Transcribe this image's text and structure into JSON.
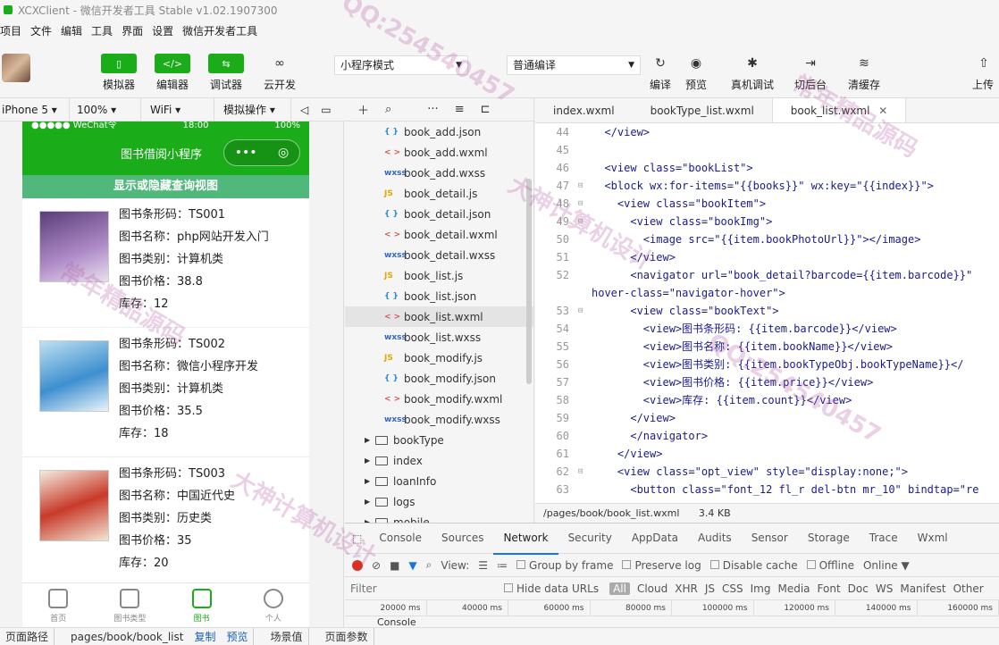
{
  "window": {
    "title": "XCXClient - 微信开发者工具 Stable v1.02.1907300"
  },
  "menu": [
    "项目",
    "文件",
    "编辑",
    "工具",
    "界面",
    "设置",
    "微信开发者工具"
  ],
  "toolbar": {
    "simulator": "模拟器",
    "editor": "编辑器",
    "debugger": "调试器",
    "cloud": "云开发",
    "mode": "小程序模式",
    "compile_mode": "普通编译",
    "compile": "编译",
    "preview": "预览",
    "remote_debug": "真机调试",
    "background": "切后台",
    "clear_cache": "清缓存",
    "upload": "上传"
  },
  "device_bar": {
    "device": "iPhone 5",
    "zoom": "100%",
    "network": "WiFi",
    "simulate": "模拟操作"
  },
  "phone": {
    "status_left": "●●●●● WeChat令",
    "status_time": "18:00",
    "status_right": "100%",
    "nav_title": "图书借阅小程序",
    "show_bar": "显示或隐藏查询视图",
    "books": [
      {
        "barcode": "图书条形码：TS001",
        "name": "图书名称：php网站开发入门",
        "type": "图书类别：计算机类",
        "price": "图书价格：38.8",
        "count": "库存：12"
      },
      {
        "barcode": "图书条形码：TS002",
        "name": "图书名称：微信小程序开发",
        "type": "图书类别：计算机类",
        "price": "图书价格：35.5",
        "count": "库存：18"
      },
      {
        "barcode": "图书条形码：TS003",
        "name": "图书名称：中国近代史",
        "type": "图书类别：历史类",
        "price": "图书价格：35",
        "count": "库存：20"
      }
    ],
    "tabs": [
      "首页",
      "图书类型",
      "图书",
      "个人"
    ]
  },
  "filetree": {
    "files": [
      {
        "ext": "{ }",
        "name": "book_add.json"
      },
      {
        "ext": "< >",
        "name": "book_add.wxml"
      },
      {
        "ext": "wxss",
        "name": "book_add.wxss"
      },
      {
        "ext": "JS",
        "name": "book_detail.js"
      },
      {
        "ext": "{ }",
        "name": "book_detail.json"
      },
      {
        "ext": "< >",
        "name": "book_detail.wxml"
      },
      {
        "ext": "wxss",
        "name": "book_detail.wxss"
      },
      {
        "ext": "JS",
        "name": "book_list.js"
      },
      {
        "ext": "{ }",
        "name": "book_list.json"
      },
      {
        "ext": "< >",
        "name": "book_list.wxml"
      },
      {
        "ext": "wxss",
        "name": "book_list.wxss"
      },
      {
        "ext": "JS",
        "name": "book_modify.js"
      },
      {
        "ext": "{ }",
        "name": "book_modify.json"
      },
      {
        "ext": "< >",
        "name": "book_modify.wxml"
      },
      {
        "ext": "wxss",
        "name": "book_modify.wxss"
      }
    ],
    "folders": [
      "bookType",
      "index",
      "loanInfo",
      "logs",
      "mobile"
    ]
  },
  "editor": {
    "tabs": [
      "index.wxml",
      "bookType_list.wxml",
      "book_list.wxml"
    ],
    "lines": [
      {
        "n": "44",
        "code": "  </view>"
      },
      {
        "n": "45",
        "code": ""
      },
      {
        "n": "46",
        "code": "  <view class=\"bookList\">"
      },
      {
        "n": "47",
        "code": "  <block wx:for-items=\"{{books}}\" wx:key=\"{{index}}\">"
      },
      {
        "n": "48",
        "code": "    <view class=\"bookItem\">"
      },
      {
        "n": "49",
        "code": "      <view class=\"bookImg\">"
      },
      {
        "n": "50",
        "code": "        <image src=\"{{item.bookPhotoUrl}}\"></image>"
      },
      {
        "n": "51",
        "code": "      </view>"
      },
      {
        "n": "52",
        "code": "      <navigator url=\"book_detail?barcode={{item.barcode}}\""
      },
      {
        "n": "",
        "code": "hover-class=\"navigator-hover\">"
      },
      {
        "n": "53",
        "code": "      <view class=\"bookText\">"
      },
      {
        "n": "54",
        "code": "        <view>图书条形码: {{item.barcode}}</view>"
      },
      {
        "n": "55",
        "code": "        <view>图书名称: {{item.bookName}}</view>"
      },
      {
        "n": "56",
        "code": "        <view>图书类别: {{item.bookTypeObj.bookTypeName}}</"
      },
      {
        "n": "57",
        "code": "        <view>图书价格: {{item.price}}</view>"
      },
      {
        "n": "58",
        "code": "        <view>库存: {{item.count}}</view>"
      },
      {
        "n": "59",
        "code": "      </view>"
      },
      {
        "n": "60",
        "code": "      </navigator>"
      },
      {
        "n": "61",
        "code": "    </view>"
      },
      {
        "n": "62",
        "code": "    <view class=\"opt_view\" style=\"display:none;\">"
      },
      {
        "n": "63",
        "code": "      <button class=\"font_12 fl_r del-btn mr_10\" bindtap=\"re"
      }
    ],
    "path": "/pages/book/book_list.wxml",
    "size": "3.4 KB"
  },
  "devtools": {
    "tabs": [
      "Console",
      "Sources",
      "Network",
      "Security",
      "AppData",
      "Audits",
      "Sensor",
      "Storage",
      "Trace",
      "Wxml"
    ],
    "active_tab": "Network",
    "view_label": "View:",
    "group_by_frame": "Group by frame",
    "preserve_log": "Preserve log",
    "disable_cache": "Disable cache",
    "offline": "Offline",
    "online": "Online",
    "filter_placeholder": "Filter",
    "hide_data_urls": "Hide data URLs",
    "types": [
      "All",
      "Cloud",
      "XHR",
      "JS",
      "CSS",
      "Img",
      "Media",
      "Font",
      "Doc",
      "WS",
      "Manifest",
      "Other"
    ],
    "timeline": [
      "20000 ms",
      "40000 ms",
      "60000 ms",
      "80000 ms",
      "100000 ms",
      "120000 ms",
      "140000 ms",
      "160000 ms"
    ],
    "console": "Console"
  },
  "bottombar": {
    "path_label": "页面路径",
    "path": "pages/book/book_list",
    "copy": "复制",
    "preview": "预览",
    "scene": "场景值",
    "params": "页面参数"
  },
  "watermarks": [
    "QQ:254540457",
    "大神计算机设计",
    "常年精品源码",
    "大神计算机设计",
    "QQ:254540457",
    "常年精品源码"
  ]
}
